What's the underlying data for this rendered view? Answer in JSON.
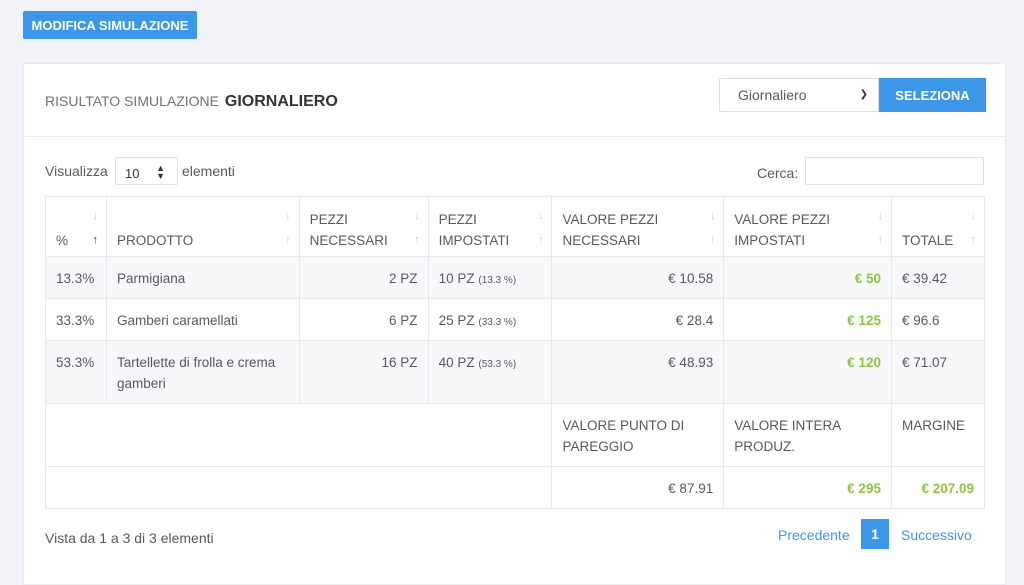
{
  "top_button": "MODIFICA SIMULAZIONE",
  "card": {
    "title_prefix": "RISULTATO SIMULAZIONE",
    "title_period": "GIORNALIERO",
    "period_select_value": "Giornaliero",
    "select_button": "SELEZIONA"
  },
  "toolbar": {
    "show_label": "Visualizza",
    "page_length": "10",
    "show_after": "elementi",
    "search_label": "Cerca:",
    "search_value": ""
  },
  "table": {
    "headers": [
      "%",
      "PRODOTTO",
      "PEZZI NECESSARI",
      "PEZZI IMPOSTATI",
      "VALORE PEZZI NECESSARI",
      "VALORE PEZZI IMPOSTATI",
      "TOTALE"
    ],
    "rows": [
      {
        "pct": "13.3%",
        "product": "Parmigiana",
        "needed": "2 PZ",
        "set": "10 PZ",
        "set_pct": "(13.3 %)",
        "val_needed": "€ 10.58",
        "val_set": "€ 50",
        "total": "€ 39.42"
      },
      {
        "pct": "33.3%",
        "product": "Gamberi caramellati",
        "needed": "6 PZ",
        "set": "25 PZ",
        "set_pct": "(33.3 %)",
        "val_needed": "€ 28.4",
        "val_set": "€ 125",
        "total": "€ 96.6"
      },
      {
        "pct": "53.3%",
        "product": "Tartellette di frolla e crema gamberi",
        "needed": "16 PZ",
        "set": "40 PZ",
        "set_pct": "(53.3 %)",
        "val_needed": "€ 48.93",
        "val_set": "€ 120",
        "total": "€ 71.07"
      }
    ],
    "summary_labels": {
      "break_even": "VALORE PUNTO DI PAREGGIO",
      "full_production": "VALORE INTERA PRODUZ.",
      "margin": "MARGINE"
    },
    "summary_values": {
      "break_even": "€ 87.91",
      "full_production": "€ 295",
      "margin": "€ 207.09"
    }
  },
  "footer": {
    "info": "Vista da 1 a 3 di 3 elementi",
    "prev": "Precedente",
    "page": "1",
    "next": "Successivo"
  },
  "colors": {
    "accent": "#3c97e8",
    "positive": "#8dc63f"
  }
}
